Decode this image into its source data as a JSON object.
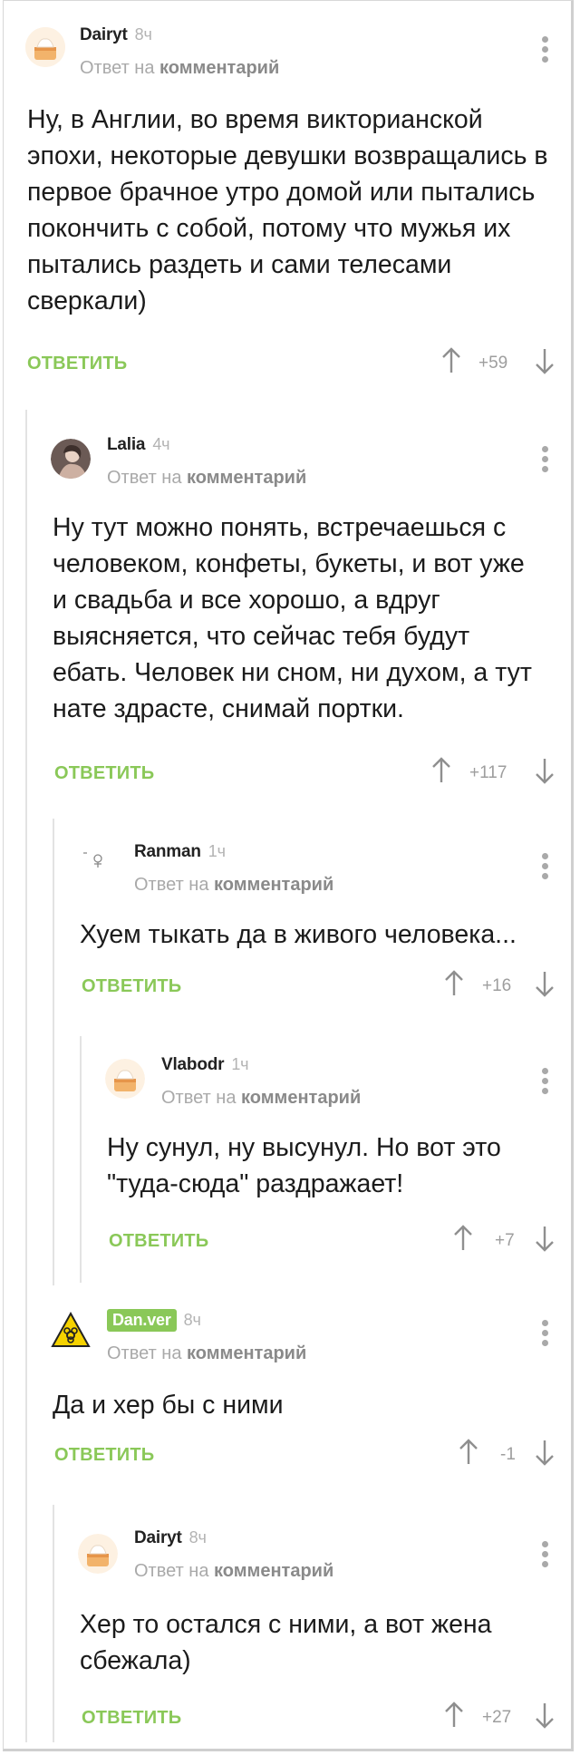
{
  "reply_to_prefix": "Ответ на",
  "reply_to_target": "комментарий",
  "reply_button": "ОТВЕТИТЬ",
  "accent_color": "#8ac858",
  "comments": [
    {
      "author": "Dairyt",
      "time": "8ч",
      "rating": "+59",
      "text": "Ну, в Англии, во время викторианской эпохи, некоторые девушки возвращались в первое брачное утро домой или пытались покончить с собой, потому что мужья их пытались раздеть и сами телесами сверкали)"
    },
    {
      "author": "Lalia",
      "time": "4ч",
      "rating": "+117",
      "text": "Ну тут можно понять, встречаешься с человеком, конфеты, букеты, и вот уже и свадьба и все хорошо, а вдруг выясняется, что сейчас тебя будут ебать. Человек ни сном, ни духом, а тут нате здрасте, снимай портки."
    },
    {
      "author": "Ranman",
      "time": "1ч",
      "rating": "+16",
      "text": "Хуем тыкать да в живого человека..."
    },
    {
      "author": "Vlabodr",
      "time": "1ч",
      "rating": "+7",
      "text": "Ну сунул, ну высунул. Но вот это \"туда-сюда\" раздражает!"
    },
    {
      "author": "Dan.ver",
      "time": "8ч",
      "rating": "-1",
      "text": "Да и хер бы с ними"
    },
    {
      "author": "Dairyt",
      "time": "8ч",
      "rating": "+27",
      "text": "Хер то остался с ними, а вот жена сбежала)"
    }
  ]
}
